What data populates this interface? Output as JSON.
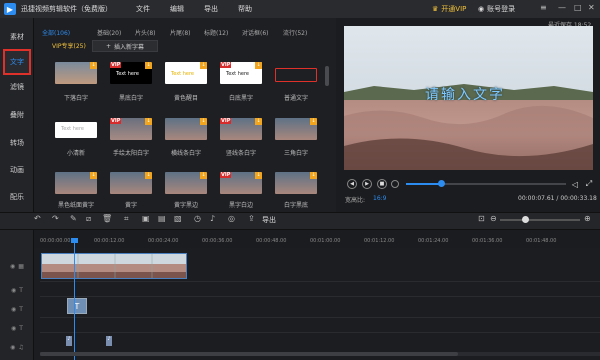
{
  "titlebar": {
    "app_name": "迅捷视频剪辑软件（免费版）",
    "menus": [
      "文件",
      "编辑",
      "导出",
      "帮助"
    ],
    "vip_label": "开通VIP",
    "login_label": "账号登录"
  },
  "sidebar": {
    "items": [
      "素材",
      "文字",
      "滤镜",
      "叠附",
      "转场",
      "动画",
      "配乐"
    ],
    "active_index": 1
  },
  "media": {
    "tabs": [
      "全部(106)",
      "基础(20)",
      "片头(8)",
      "片尾(8)",
      "标题(12)",
      "对话框(6)",
      "流行(52)"
    ],
    "active_tab": 0,
    "vip_tag": "VIP专享(25)",
    "insert_button": "插入新字幕",
    "rows": [
      [
        "下落白字",
        "黑底白字",
        "黄色醒目",
        "白底黑字",
        "普通文字"
      ],
      [
        "小清新",
        "手绘太阳白字",
        "横线条白字",
        "竖线条白字",
        "三角白字"
      ],
      [
        "黑色纸面黄字",
        "黄字",
        "黄字黑边",
        "黑字白边",
        "白字黑底"
      ]
    ],
    "thumb_text": "Text here"
  },
  "preview": {
    "label": "最近保存 18:52",
    "overlay_text": "请输入文字",
    "progress": 0.22,
    "ratio_label": "宽高比:",
    "ratio_value": "16:9",
    "timecode": "00:00:07.61 / 00:00:33.18"
  },
  "toolbar": {
    "export_label": "导出"
  },
  "ruler": {
    "ticks": [
      "00:00:00.00",
      "00:00:12.00",
      "00:00:24.00",
      "00:00:36.00",
      "00:00:48.00",
      "00:01:00.00",
      "00:01:12.00",
      "00:01:24.00",
      "00:01:36.00",
      "00:01:48.00"
    ]
  },
  "colors": {
    "accent": "#2d8cf0",
    "vip": "#f2c23a",
    "highlight_box": "#e0302a"
  }
}
